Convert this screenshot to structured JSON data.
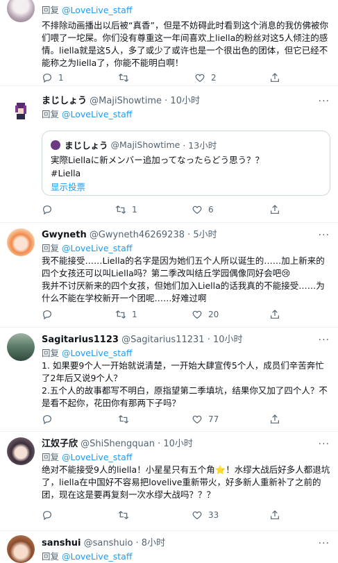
{
  "tweets": [
    {
      "name": "",
      "handle": "",
      "time": "",
      "reply_prefix": "回复",
      "reply_to": "@LoveLive_staff",
      "text": "不排除动画播出以后被“真香”，但是不妨碍此时看到这个消息的我仿佛被你们喂了一坨屎。你们没有尊重这一年间喜欢上liella的粉丝对这5人倾注的感情。liella就是这5人，多了或少了或许也是一个很出色的团体，但它已经不能称之为liella了，你能不能明白啊！",
      "counts": {
        "reply": "1",
        "retweet": "",
        "like": "2"
      }
    },
    {
      "name": "まじしょう",
      "handle": "@MajiShowtime",
      "time": "· 10小时",
      "reply_prefix": "回复",
      "reply_to": "@LoveLive_staff",
      "text": "",
      "quote": {
        "name": "まじしょう",
        "handle": "@MajiShowtime",
        "time": "· 13小时",
        "text": "実際Liellaに新メンバー追加ってなったらどう思う？？\n#Liella",
        "link": "显示投票"
      },
      "counts": {
        "reply": "",
        "retweet": "1",
        "like": "6"
      }
    },
    {
      "name": "Gwyneth",
      "handle": "@Gwyneth46269238",
      "time": "· 5小时",
      "reply_prefix": "回复",
      "reply_to": "@LoveLive_staff",
      "text": "我不能接受……Liella的名字是因为她们五个人所以诞生的……加上新来的四个女孩还可以叫Liella吗？第二季改叫结丘学园偶像同好会吧😢\n我并不讨厌新来的四个女孩，但她们加入Liella的话我真的不能接受……为什么不能在学校新开一个团呢……好难过啊",
      "counts": {
        "reply": "",
        "retweet": "1",
        "like": "20"
      }
    },
    {
      "name": "Sagitarius1123",
      "handle": "@Sagitarius11231",
      "time": "· 10小时",
      "reply_prefix": "回复",
      "reply_to": "@LoveLive_staff",
      "text": "1. 如果要9个人一开始就说清楚，一开始大肆宣传5个人，成员们辛苦奔忙了2年后又说9个人？\n2.五个人的故事都写不明白，原指望第二季填坑，结果你又加了四个人？不是看不起你，花田你有那两下子吗？",
      "counts": {
        "reply": "",
        "retweet": "",
        "like": "77"
      }
    },
    {
      "name": "江奴子欣",
      "handle": "@ShiShengquan",
      "time": "· 10小时",
      "reply_prefix": "回复",
      "reply_to": "@LoveLive_staff",
      "text": "绝对不能接受9人的liella！小星星只有五个角⭐！水缪大战后好多人都退坑了，liella在中国好不容易把lovelive重新带火，好多新人重新补了之前的团，现在这是要再复刻一次水缪大战吗？？？",
      "counts": {
        "reply": "",
        "retweet": "",
        "like": "33"
      }
    },
    {
      "name": "sanshui",
      "handle": "@sanshuio",
      "time": "· 8小时",
      "reply_prefix": "回复",
      "reply_to": "@LoveLive_staff",
      "text": "",
      "counts": {
        "reply": "",
        "retweet": "",
        "like": ""
      }
    }
  ],
  "icons": {
    "reply": "reply-icon",
    "retweet": "retweet-icon",
    "like": "like-icon",
    "share": "share-icon",
    "more": "more-icon"
  },
  "colors": {
    "link": "#1d9bf0",
    "secondary": "#536471",
    "border": "#eff3f4"
  }
}
